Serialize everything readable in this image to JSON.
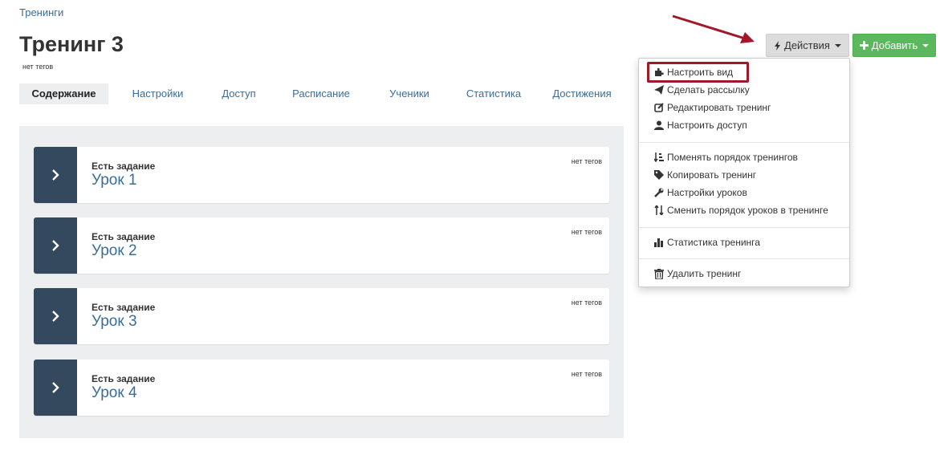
{
  "breadcrumb": "Тренинги",
  "title": "Тренинг 3",
  "tags_label": "нет тегов",
  "tabs": [
    {
      "label": "Содержание",
      "active": true
    },
    {
      "label": "Настройки"
    },
    {
      "label": "Доступ"
    },
    {
      "label": "Расписание"
    },
    {
      "label": "Ученики"
    },
    {
      "label": "Статистика"
    },
    {
      "label": "Достижения"
    }
  ],
  "buttons": {
    "actions": {
      "label": "Действия",
      "icon": "bolt-icon"
    },
    "add": {
      "label": "Добавить",
      "icon": "plus-icon"
    }
  },
  "lessons": [
    {
      "status": "Есть задание",
      "title": "Урок 1",
      "tags": "нет тегов"
    },
    {
      "status": "Есть задание",
      "title": "Урок 2",
      "tags": "нет тегов"
    },
    {
      "status": "Есть задание",
      "title": "Урок 3",
      "tags": "нет тегов"
    },
    {
      "status": "Есть задание",
      "title": "Урок 4",
      "tags": "нет тегов"
    }
  ],
  "actions_menu": [
    {
      "label": "Настроить вид",
      "icon": "puzzle-icon",
      "highlighted": true
    },
    {
      "label": "Сделать рассылку",
      "icon": "send-icon"
    },
    {
      "label": "Редактировать тренинг",
      "icon": "edit-icon"
    },
    {
      "label": "Настроить доступ",
      "icon": "user-icon"
    },
    {
      "label": "Поменять порядок тренингов",
      "icon": "sort-icon"
    },
    {
      "label": "Копировать тренинг",
      "icon": "tags-icon"
    },
    {
      "label": "Настройки уроков",
      "icon": "wrench-icon"
    },
    {
      "label": "Сменить порядок уроков в тренинге",
      "icon": "sort-arrows-icon"
    },
    {
      "label": "Статистика тренинга",
      "icon": "bar-chart-icon"
    },
    {
      "label": "Удалить тренинг",
      "icon": "trash-icon"
    }
  ],
  "colors": {
    "link": "#3a6d99",
    "expand_bg": "#34495e",
    "add_button": "#5cb85c",
    "annotation": "#a01829"
  }
}
